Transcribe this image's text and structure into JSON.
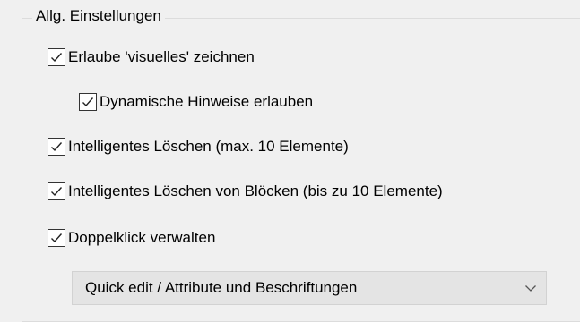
{
  "group": {
    "title": "Allg. Einstellungen"
  },
  "options": [
    {
      "label": "Erlaube 'visuelles' zeichnen",
      "checked": true
    },
    {
      "label": "Dynamische Hinweise erlauben",
      "checked": true
    },
    {
      "label": "Intelligentes Löschen (max. 10 Elemente)",
      "checked": true
    },
    {
      "label": "Intelligentes Löschen von Blöcken (bis zu 10 Elemente)",
      "checked": true
    },
    {
      "label": "Doppelklick verwalten",
      "checked": true
    }
  ],
  "double_click_action": {
    "selected": "Quick edit / Attribute und Beschriftungen",
    "icon": "chevron-down-icon"
  },
  "colors": {
    "background": "#f0f0f0",
    "checkbox_border": "#333333",
    "combo_background": "#e4e4e4"
  }
}
